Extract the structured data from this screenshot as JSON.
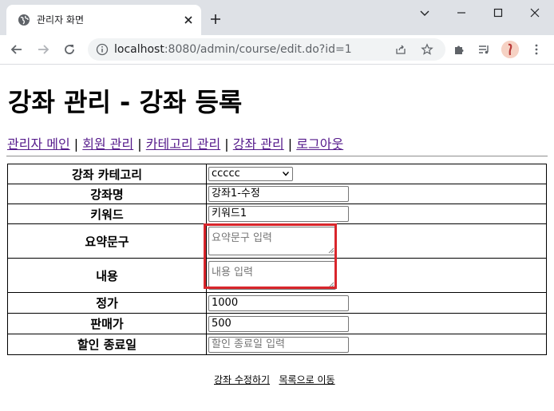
{
  "browser": {
    "tab_title": "관리자 화면",
    "url_host": "localhost",
    "url_rest": ":8080/admin/course/edit.do?id=1"
  },
  "page": {
    "title": "강좌 관리 - 강좌 등록",
    "nav": {
      "items": [
        "관리자 메인",
        "회원 관리",
        "카테고리 관리",
        "강좌 관리",
        "로그아웃"
      ],
      "separator": " | "
    },
    "form": {
      "category_label": "강좌 카테고리",
      "category_value": "ccccc",
      "name_label": "강좌명",
      "name_value": "강좌1-수정",
      "keyword_label": "키워드",
      "keyword_value": "키워드1",
      "summary_label": "요약문구",
      "summary_placeholder": "요약문구 입력",
      "content_label": "내용",
      "content_placeholder": "내용 입력",
      "price_label": "정가",
      "price_value": "1000",
      "sale_price_label": "판매가",
      "sale_price_value": "500",
      "sale_end_label": "할인 종료일",
      "sale_end_placeholder": "할인 종료일 입력"
    },
    "actions": {
      "submit_label": "강좌 수정하기",
      "list_label": "목록으로 이동"
    }
  },
  "colors": {
    "highlight": "#d9262c",
    "visited_link": "#551a8b"
  }
}
